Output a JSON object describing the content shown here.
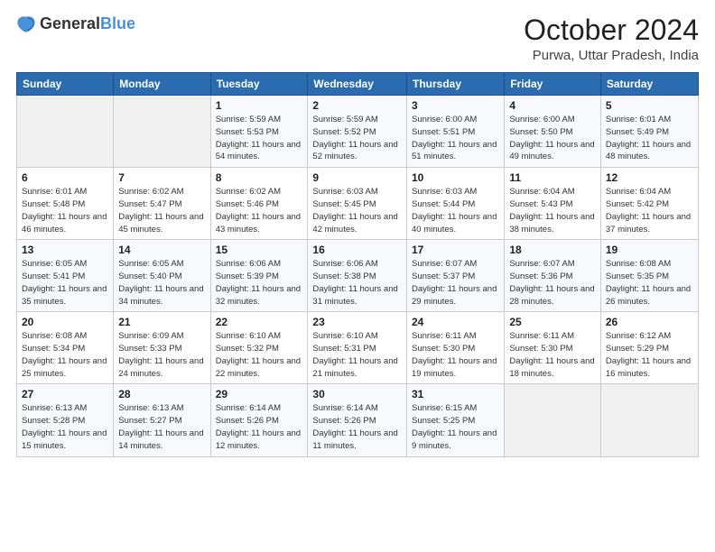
{
  "header": {
    "logo_general": "General",
    "logo_blue": "Blue",
    "month": "October 2024",
    "location": "Purwa, Uttar Pradesh, India"
  },
  "weekdays": [
    "Sunday",
    "Monday",
    "Tuesday",
    "Wednesday",
    "Thursday",
    "Friday",
    "Saturday"
  ],
  "weeks": [
    [
      {
        "day": "",
        "detail": ""
      },
      {
        "day": "",
        "detail": ""
      },
      {
        "day": "1",
        "detail": "Sunrise: 5:59 AM\nSunset: 5:53 PM\nDaylight: 11 hours and 54 minutes."
      },
      {
        "day": "2",
        "detail": "Sunrise: 5:59 AM\nSunset: 5:52 PM\nDaylight: 11 hours and 52 minutes."
      },
      {
        "day": "3",
        "detail": "Sunrise: 6:00 AM\nSunset: 5:51 PM\nDaylight: 11 hours and 51 minutes."
      },
      {
        "day": "4",
        "detail": "Sunrise: 6:00 AM\nSunset: 5:50 PM\nDaylight: 11 hours and 49 minutes."
      },
      {
        "day": "5",
        "detail": "Sunrise: 6:01 AM\nSunset: 5:49 PM\nDaylight: 11 hours and 48 minutes."
      }
    ],
    [
      {
        "day": "6",
        "detail": "Sunrise: 6:01 AM\nSunset: 5:48 PM\nDaylight: 11 hours and 46 minutes."
      },
      {
        "day": "7",
        "detail": "Sunrise: 6:02 AM\nSunset: 5:47 PM\nDaylight: 11 hours and 45 minutes."
      },
      {
        "day": "8",
        "detail": "Sunrise: 6:02 AM\nSunset: 5:46 PM\nDaylight: 11 hours and 43 minutes."
      },
      {
        "day": "9",
        "detail": "Sunrise: 6:03 AM\nSunset: 5:45 PM\nDaylight: 11 hours and 42 minutes."
      },
      {
        "day": "10",
        "detail": "Sunrise: 6:03 AM\nSunset: 5:44 PM\nDaylight: 11 hours and 40 minutes."
      },
      {
        "day": "11",
        "detail": "Sunrise: 6:04 AM\nSunset: 5:43 PM\nDaylight: 11 hours and 38 minutes."
      },
      {
        "day": "12",
        "detail": "Sunrise: 6:04 AM\nSunset: 5:42 PM\nDaylight: 11 hours and 37 minutes."
      }
    ],
    [
      {
        "day": "13",
        "detail": "Sunrise: 6:05 AM\nSunset: 5:41 PM\nDaylight: 11 hours and 35 minutes."
      },
      {
        "day": "14",
        "detail": "Sunrise: 6:05 AM\nSunset: 5:40 PM\nDaylight: 11 hours and 34 minutes."
      },
      {
        "day": "15",
        "detail": "Sunrise: 6:06 AM\nSunset: 5:39 PM\nDaylight: 11 hours and 32 minutes."
      },
      {
        "day": "16",
        "detail": "Sunrise: 6:06 AM\nSunset: 5:38 PM\nDaylight: 11 hours and 31 minutes."
      },
      {
        "day": "17",
        "detail": "Sunrise: 6:07 AM\nSunset: 5:37 PM\nDaylight: 11 hours and 29 minutes."
      },
      {
        "day": "18",
        "detail": "Sunrise: 6:07 AM\nSunset: 5:36 PM\nDaylight: 11 hours and 28 minutes."
      },
      {
        "day": "19",
        "detail": "Sunrise: 6:08 AM\nSunset: 5:35 PM\nDaylight: 11 hours and 26 minutes."
      }
    ],
    [
      {
        "day": "20",
        "detail": "Sunrise: 6:08 AM\nSunset: 5:34 PM\nDaylight: 11 hours and 25 minutes."
      },
      {
        "day": "21",
        "detail": "Sunrise: 6:09 AM\nSunset: 5:33 PM\nDaylight: 11 hours and 24 minutes."
      },
      {
        "day": "22",
        "detail": "Sunrise: 6:10 AM\nSunset: 5:32 PM\nDaylight: 11 hours and 22 minutes."
      },
      {
        "day": "23",
        "detail": "Sunrise: 6:10 AM\nSunset: 5:31 PM\nDaylight: 11 hours and 21 minutes."
      },
      {
        "day": "24",
        "detail": "Sunrise: 6:11 AM\nSunset: 5:30 PM\nDaylight: 11 hours and 19 minutes."
      },
      {
        "day": "25",
        "detail": "Sunrise: 6:11 AM\nSunset: 5:30 PM\nDaylight: 11 hours and 18 minutes."
      },
      {
        "day": "26",
        "detail": "Sunrise: 6:12 AM\nSunset: 5:29 PM\nDaylight: 11 hours and 16 minutes."
      }
    ],
    [
      {
        "day": "27",
        "detail": "Sunrise: 6:13 AM\nSunset: 5:28 PM\nDaylight: 11 hours and 15 minutes."
      },
      {
        "day": "28",
        "detail": "Sunrise: 6:13 AM\nSunset: 5:27 PM\nDaylight: 11 hours and 14 minutes."
      },
      {
        "day": "29",
        "detail": "Sunrise: 6:14 AM\nSunset: 5:26 PM\nDaylight: 11 hours and 12 minutes."
      },
      {
        "day": "30",
        "detail": "Sunrise: 6:14 AM\nSunset: 5:26 PM\nDaylight: 11 hours and 11 minutes."
      },
      {
        "day": "31",
        "detail": "Sunrise: 6:15 AM\nSunset: 5:25 PM\nDaylight: 11 hours and 9 minutes."
      },
      {
        "day": "",
        "detail": ""
      },
      {
        "day": "",
        "detail": ""
      }
    ]
  ]
}
